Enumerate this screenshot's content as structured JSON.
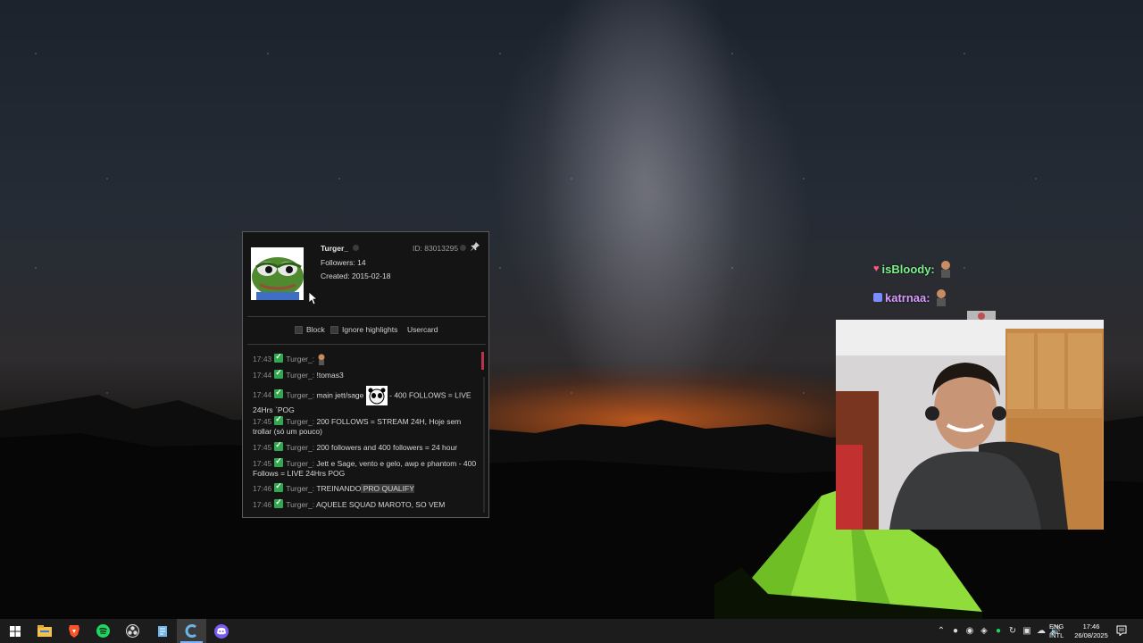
{
  "usercard": {
    "username": "Turger_",
    "followers": "Followers: 14",
    "created": "Created: 2015-02-18",
    "user_id": "ID: 83013295",
    "options": [
      {
        "label": "Block"
      },
      {
        "label": "Ignore highlights"
      }
    ],
    "usercard_link": "Usercard",
    "messages": [
      {
        "time": "17:43",
        "nick": "Turger_:",
        "text": ""
      },
      {
        "time": "17:44",
        "nick": "Turger_:",
        "text": "!tomas3"
      },
      {
        "time": "17:44",
        "nick": "Turger_:",
        "text": "main jett/sage",
        "text2": " - 400 FOLLOWS = LIVE 24Hrs `POG"
      },
      {
        "time": "17:45",
        "nick": "Turger_:",
        "text": "200 FOLLOWS = STREAM 24H, Hoje sem trollar (só um pouco)"
      },
      {
        "time": "17:45",
        "nick": "Turger_:",
        "text": "200 followers and 400 followers = 24 hour"
      },
      {
        "time": "17:45",
        "nick": "Turger_:",
        "text": "Jett e Sage, vento e gelo, awp e phantom - 400 Follows = LIVE 24Hrs POG"
      },
      {
        "time": "17:46",
        "nick": "Turger_:",
        "text": "TREINANDO",
        "text_hl": " PRO QUALIFY"
      },
      {
        "time": "17:46",
        "nick": "Turger_:",
        "text": "AQUELE SQUAD MAROTO, SO VEM"
      }
    ]
  },
  "overlay_chat": [
    {
      "name": "isBloody:",
      "color": "#7cf08a"
    },
    {
      "name": "katrnaa:",
      "color": "#d79cff"
    }
  ],
  "taskbar": {
    "apps": [
      {
        "icon": "windows-start-icon"
      },
      {
        "icon": "file-explorer-icon"
      },
      {
        "icon": "brave-browser-icon"
      },
      {
        "icon": "spotify-icon"
      },
      {
        "icon": "obs-icon"
      },
      {
        "icon": "notepad-icon"
      },
      {
        "icon": "chatterino-icon",
        "active": true
      },
      {
        "icon": "discord-icon"
      }
    ],
    "language_top": "ENG",
    "language_bottom": "INTL",
    "time": "17:46",
    "date": "26/08/2025"
  }
}
